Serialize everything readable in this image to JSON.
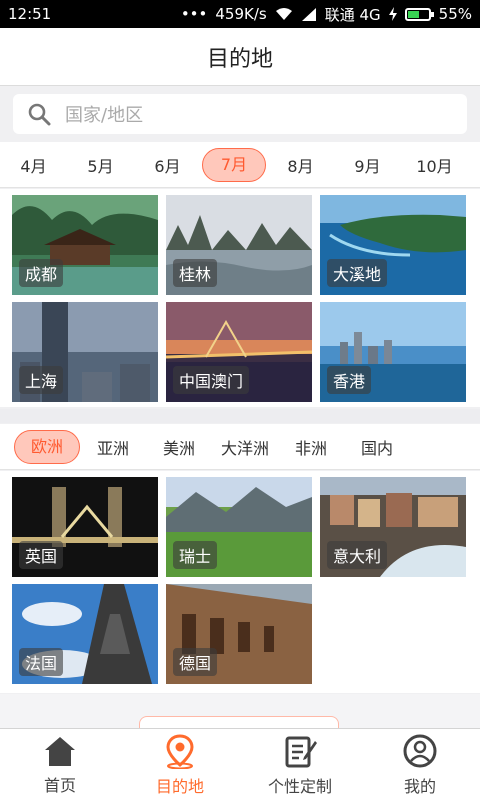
{
  "status": {
    "time": "12:51",
    "dots": "•••",
    "speed": "459K/s",
    "carrier": "联通 4G",
    "battery": "55%",
    "battery_level": 0.55
  },
  "header": {
    "title": "目的地"
  },
  "search": {
    "placeholder": "国家/地区"
  },
  "months": [
    "4月",
    "5月",
    "6月",
    "7月",
    "8月",
    "9月",
    "10月"
  ],
  "active_month": "7月",
  "month_destinations": [
    "成都",
    "桂林",
    "大溪地",
    "上海",
    "中国澳门",
    "香港"
  ],
  "regions": [
    "欧洲",
    "亚洲",
    "美洲",
    "大洋洲",
    "非洲",
    "国内"
  ],
  "active_region": "欧洲",
  "region_destinations": [
    "英国",
    "瑞士",
    "意大利",
    "法国",
    "德国"
  ],
  "tabs": [
    {
      "label": "首页",
      "icon": "home-icon"
    },
    {
      "label": "目的地",
      "icon": "location-pin-icon"
    },
    {
      "label": "个性定制",
      "icon": "edit-note-icon"
    },
    {
      "label": "我的",
      "icon": "user-icon"
    }
  ],
  "colors": {
    "accent": "#ff6b2d",
    "active_pill_bg": "#ffc8bb"
  }
}
